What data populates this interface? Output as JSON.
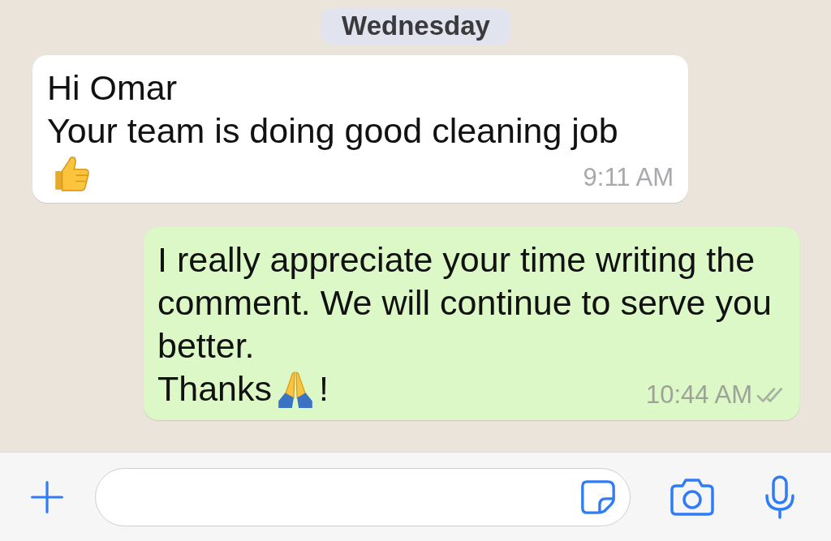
{
  "date_divider": "Wednesday",
  "messages": [
    {
      "kind": "incoming",
      "lines": [
        {
          "kind": "text",
          "text": "Hi Omar"
        },
        {
          "kind": "text",
          "text": "Your team is doing good cleaning job"
        },
        {
          "kind": "thumbs_up"
        }
      ],
      "time": "9:11 AM"
    },
    {
      "kind": "outgoing",
      "lines": [
        {
          "kind": "text",
          "text": "I really appreciate your time writing the comment. We will continue to serve you better."
        },
        {
          "kind": "pray",
          "text": "Thanks",
          "after": "!"
        }
      ],
      "time": "10:44 AM",
      "delivered": true,
      "read": false
    }
  ]
}
